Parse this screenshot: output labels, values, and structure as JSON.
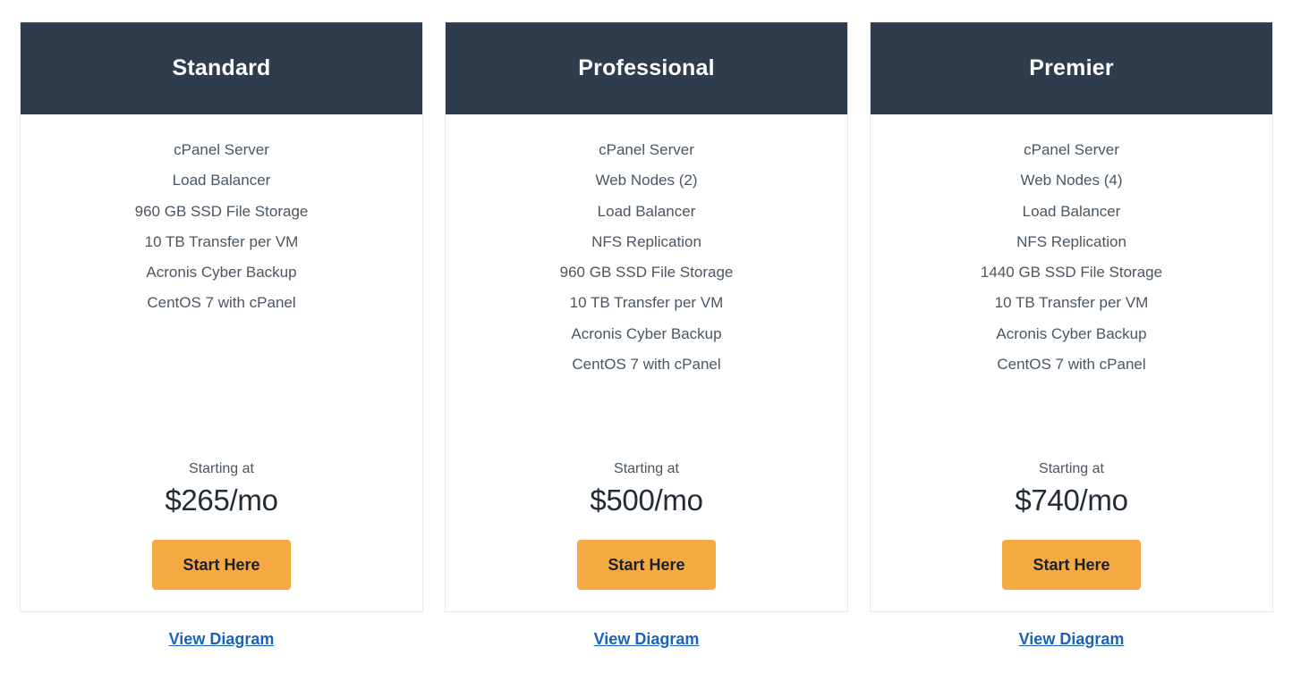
{
  "plans": [
    {
      "name": "Standard",
      "features": [
        "cPanel Server",
        "Load Balancer",
        "960 GB SSD File Storage",
        "10 TB Transfer per VM",
        "Acronis Cyber Backup",
        "CentOS 7 with cPanel"
      ],
      "price_label": "Starting at",
      "price": "$265/mo",
      "cta_label": "Start Here",
      "diagram_link": "View Diagram"
    },
    {
      "name": "Professional",
      "features": [
        "cPanel Server",
        "Web Nodes (2)",
        "Load Balancer",
        "NFS Replication",
        "960 GB SSD File Storage",
        "10 TB Transfer per VM",
        "Acronis Cyber Backup",
        "CentOS 7 with cPanel"
      ],
      "price_label": "Starting at",
      "price": "$500/mo",
      "cta_label": "Start Here",
      "diagram_link": "View Diagram"
    },
    {
      "name": "Premier",
      "features": [
        "cPanel Server",
        "Web Nodes (4)",
        "Load Balancer",
        "NFS Replication",
        "1440 GB SSD File Storage",
        "10 TB Transfer per VM",
        "Acronis Cyber Backup",
        "CentOS 7 with cPanel"
      ],
      "price_label": "Starting at",
      "price": "$740/mo",
      "cta_label": "Start Here",
      "diagram_link": "View Diagram"
    }
  ],
  "colors": {
    "header_background": "#2e3c4e",
    "cta_background": "#f5a942",
    "link": "#1c63b8",
    "card_border": "#e6eaf0",
    "feature_text": "#495663"
  }
}
